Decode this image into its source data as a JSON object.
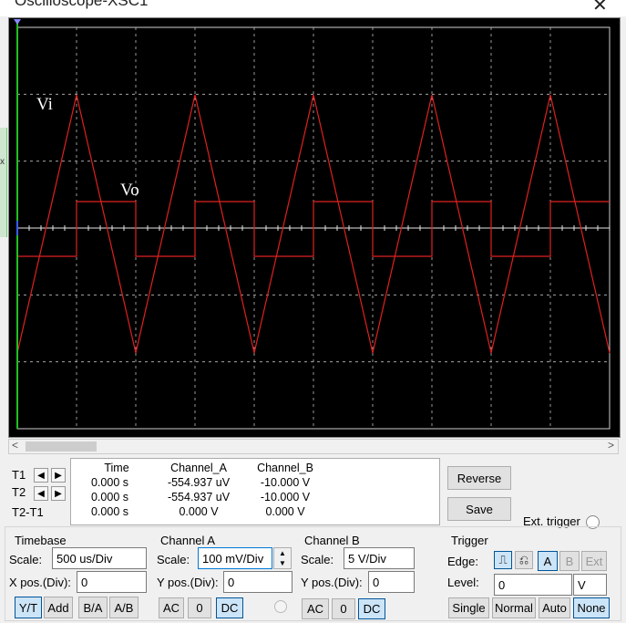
{
  "window": {
    "title": "Oscilloscope-XSC1",
    "close_glyph": "✕"
  },
  "left_strip": {
    "label": "x"
  },
  "screen": {
    "background": "#000000",
    "grid_color": "#bdbdbd",
    "trace_color": "#e02020",
    "cursor_color": "#22c022",
    "labels": {
      "vi": "Vi",
      "vo": "Vo"
    },
    "icon": "trigger-marker-icon"
  },
  "scrollbar": {
    "left_glyph": "<",
    "right_glyph": ">"
  },
  "cursors": {
    "headers": [
      "Time",
      "Channel_A",
      "Channel_B"
    ],
    "rows": [
      {
        "label": "T1",
        "left_icon": "arrow-left-icon",
        "right_icon": "arrow-right-icon",
        "time": "0.000 s",
        "a": "-554.937 uV",
        "b": "-10.000 V"
      },
      {
        "label": "T2",
        "left_icon": "arrow-left-icon",
        "right_icon": "arrow-right-icon",
        "time": "0.000 s",
        "a": "-554.937 uV",
        "b": "-10.000 V"
      },
      {
        "label": "T2-T1",
        "time": "0.000 s",
        "a": "0.000 V",
        "b": "0.000 V"
      }
    ],
    "arrow_left": "◀",
    "arrow_right": "▶"
  },
  "actions": {
    "reverse": "Reverse",
    "save": "Save",
    "ext_trigger": "Ext. trigger"
  },
  "timebase": {
    "title": "Timebase",
    "scale_label": "Scale:",
    "scale_value": "500 us/Div",
    "xpos_label": "X pos.(Div):",
    "xpos_value": "0",
    "buttons": [
      "Y/T",
      "Add",
      "B/A",
      "A/B"
    ],
    "selected": "Y/T"
  },
  "channel_a": {
    "title": "Channel A",
    "scale_label": "Scale:",
    "scale_value": "100 mV/Div",
    "ypos_label": "Y pos.(Div):",
    "ypos_value": "0",
    "coupling": [
      "AC",
      "0",
      "DC"
    ],
    "selected": "DC"
  },
  "channel_b": {
    "title": "Channel B",
    "scale_label": "Scale:",
    "scale_value": "5  V/Div",
    "ypos_label": "Y pos.(Div):",
    "ypos_value": "0",
    "coupling": [
      "AC",
      "0",
      "DC"
    ],
    "selected": "DC"
  },
  "trigger": {
    "title": "Trigger",
    "edge_label": "Edge:",
    "edge_rise_icon": "rising-edge-icon",
    "edge_fall_icon": "falling-edge-icon",
    "edge_rise_glyph": "⎍",
    "edge_fall_glyph": "⎌",
    "sources": [
      "A",
      "B",
      "Ext"
    ],
    "selected_source": "A",
    "level_label": "Level:",
    "level_value": "0",
    "level_unit": "V",
    "modes": [
      "Single",
      "Normal",
      "Auto",
      "None"
    ],
    "selected_mode": "None"
  }
}
